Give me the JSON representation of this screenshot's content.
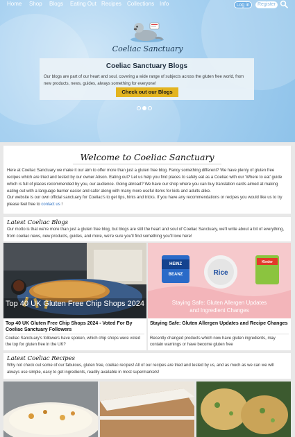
{
  "nav": {
    "items": [
      "Home",
      "Shop",
      "Blogs",
      "Eating Out",
      "Recipes",
      "Collections",
      "Info"
    ],
    "login_label": "Log in",
    "register_label": "Register"
  },
  "hero": {
    "site_title": "Coeliac Sanctuary",
    "card_title": "Coeliac Sanctuary Blogs",
    "card_text": "Our blogs are part of our heart and soul, covering a wide range of subjects across the gluten free world, from new products, news, guides, always something for everyone!",
    "cta_label": "Check out our Blogs",
    "slide_count": 3,
    "active_slide": 1
  },
  "welcome": {
    "title": "Welcome to Coeliac Sanctuary",
    "p1": "Here at Coeliac Sanctuary we make it our aim to offer more than just a gluten free blog. Fancy something different? We have plenty of gluten free recipes which are tried and tested by our owner Alison. Eating out? Let us help you find places to safely eat as a Coeliac with our 'Where to eat' guide which is full of places recommended by you, our audience. Going abroad? We have our shop where you can buy translation cards aimed at making eating out with a language barrier easier and safer along with many more useful items for kids and adults alike.",
    "p2_text": "Our website is our own official sanctuary for Coeliac's to get tips, hints and tricks. If you have any recommendations or recipes you would like us to try please feel free to",
    "p2_link": "contact us",
    "p2_end": "!"
  },
  "latest_blogs": {
    "title": "Latest Coeliac Blogs",
    "intro": "Our motto is that we're more than just a gluten free blog, but blogs are still the heart and soul of Coeliac Sanctuary, we'll write about a bit of everything, from coeliac news, new products, guides, and more, we're sure you'll find something you'll love here!",
    "items": [
      {
        "image_caption": "Top 40 UK Gluten Free Chip Shops 2024",
        "title": "Top 40 UK Gluten Free Chip Shops 2024 - Voted For By Coeliac Sanctuary Followers",
        "description": "Coeliac Sanctuary's followers have spoken, which chip shops were voted the top for gluten free in the UK?"
      },
      {
        "image_caption": "Staying Safe: Gluten Allergen Updates and Ingredient Changes",
        "title": "Staying Safe: Gluten Allergen Updates and Recipe Changes",
        "description": "Recently changed products which now have gluten ingredients, may contain warnings or have become gluten free",
        "product_labels": [
          "HEINZ",
          "BEANZ",
          "Rice",
          "Kinder"
        ]
      }
    ]
  },
  "latest_recipes": {
    "title": "Latest Coeliac Recipes",
    "intro": "Why not check out some of our fabulous, gluten free, coeliac recipes! All of our recipes are tried and tested by us, and as much as we can we will always use simple, easy to get ingredients, readily available in most supermarkets!"
  },
  "colors": {
    "hero_bg": "#a9d2f1",
    "cta_bg": "#e3b420",
    "link": "#2a6fc2",
    "page_bg": "#e8e8e8"
  }
}
